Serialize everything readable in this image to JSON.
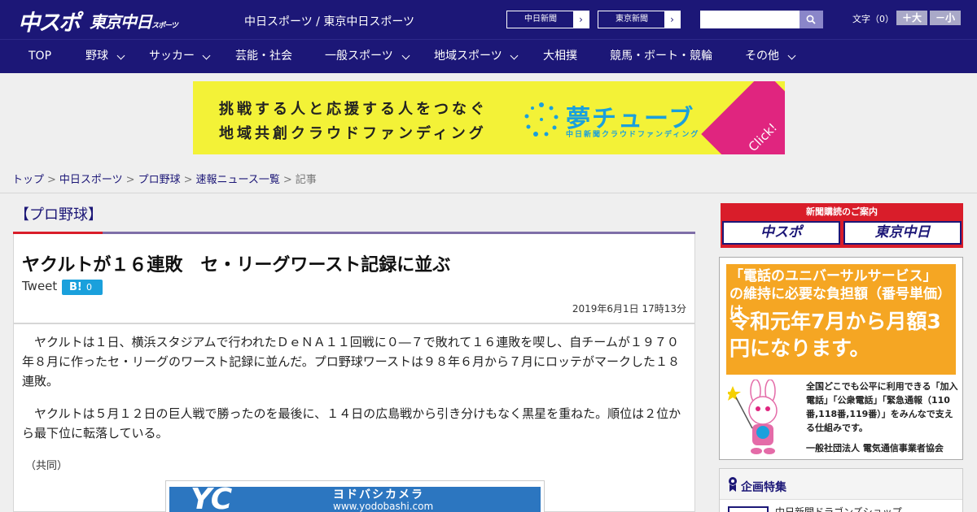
{
  "header": {
    "logo_main": "中スポ",
    "logo_sub": "東京中日",
    "logo_sub_small": "スポーツ",
    "site_name": "中日スポーツ / 東京中日スポーツ",
    "paper_links": [
      "中日新聞",
      "東京新聞"
    ],
    "search_placeholder": "",
    "font_label": "文字（0）",
    "font_larger": "＋大",
    "font_smaller": "－小"
  },
  "nav": {
    "items": [
      {
        "label": "TOP",
        "dropdown": false
      },
      {
        "label": "野球",
        "dropdown": true
      },
      {
        "label": "サッカー",
        "dropdown": true
      },
      {
        "label": "芸能・社会",
        "dropdown": false
      },
      {
        "label": "一般スポーツ",
        "dropdown": true
      },
      {
        "label": "地域スポーツ",
        "dropdown": true
      },
      {
        "label": "大相撲",
        "dropdown": false
      },
      {
        "label": "競馬・ボート・競輪",
        "dropdown": false
      },
      {
        "label": "その他",
        "dropdown": true
      }
    ]
  },
  "banner": {
    "line1": "挑戦する人と応援する人をつなぐ",
    "line2": "地域共創クラウドファンディング",
    "brand": "夢チューブ",
    "brand_sub": "中日新聞クラウドファンディング",
    "click": "Click!"
  },
  "breadcrumb": {
    "items": [
      "トップ",
      "中日スポーツ",
      "プロ野球",
      "速報ニュース一覧"
    ],
    "current": "記事"
  },
  "article": {
    "category": "【プロ野球】",
    "headline": "ヤクルトが１６連敗　セ・リーグワースト記録に並ぶ",
    "tweet": "Tweet",
    "hatena_label": "B!",
    "hatena_count": "0",
    "date": "2019年6月1日 17時13分",
    "paragraphs": [
      "ヤクルトは１日、横浜スタジアムで行われたＤｅＮＡ１１回戦に０―７で敗れて１６連敗を喫し、自チームが１９７０年８月に作ったセ・リーグのワースト記録に並んだ。プロ野球ワーストは９８年６月から７月にロッテがマークした１８連敗。",
      "ヤクルトは５月１２日の巨人戦で勝ったのを最後に、１４日の広島戦から引き分けもなく黒星を重ねた。順位は２位から最下位に転落している。"
    ],
    "credit": "（共同）",
    "ad_text1": "ヨドバシカメラ",
    "ad_text2": "www.yodobashi.com"
  },
  "sidebar": {
    "subscribe_header": "新聞購読のご案内",
    "subscribe_links": [
      "中スポ",
      "東京中日"
    ],
    "ad": {
      "line1": "「電話のユニバーサルサービス」の維持に必要な負担額（番号単価）は",
      "line2": "令和元年7月から月額3円になります。",
      "line3": "全国どこでも公平に利用できる「加入電話」「公衆電話」「緊急通報（110番,118番,119番）」をみんなで支える仕組みです。",
      "line4": "一般社団法人 電気通信事業者協会"
    },
    "feature_title": "企画特集",
    "feature_item": "中日新聞ドラゴンズショップ"
  },
  "colors": {
    "navy": "#1c1777",
    "red": "#d91d2a",
    "banner_yellow": "#f3f237",
    "banner_blue": "#1aa0dc",
    "banner_pink": "#e0257f"
  }
}
